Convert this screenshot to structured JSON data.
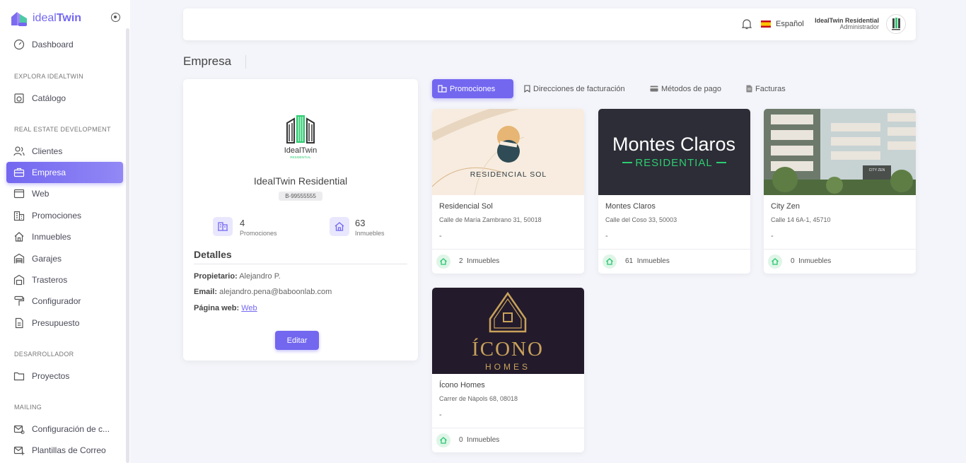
{
  "brand": {
    "name_light": "ideal",
    "name_bold": "Twin"
  },
  "sidebar": {
    "dashboard": "Dashboard",
    "section1": "EXPLORA IDEALTWIN",
    "catalogo": "Catálogo",
    "section2": "REAL ESTATE DEVELOPMENT",
    "items": [
      "Clientes",
      "Empresa",
      "Web",
      "Promociones",
      "Inmuebles",
      "Garajes",
      "Trasteros",
      "Configurador",
      "Presupuesto"
    ],
    "section3": "DESARROLLADOR",
    "proyectos": "Proyectos",
    "section4": "MAILING",
    "mailing": [
      "Configuración de c...",
      "Plantillas de Correo"
    ]
  },
  "topbar": {
    "language": "Español",
    "user_name": "IdealTwin Residential",
    "user_role": "Administrador"
  },
  "page": {
    "title": "Empresa"
  },
  "company": {
    "logo_text": "IdealTwin",
    "logo_sub": "RESIDENTIAL",
    "name": "IdealTwin Residential",
    "id": "B-99555555",
    "promociones_count": "4",
    "promociones_label": "Promociones",
    "inmuebles_count": "63",
    "inmuebles_label": "Inmuebles",
    "details_title": "Detalles",
    "owner_label": "Propietario:",
    "owner": "Alejandro P.",
    "email_label": "Email:",
    "email": "alejandro.pena@baboonlab.com",
    "web_label": "Página web:",
    "web": "Web",
    "edit": "Editar"
  },
  "tabs": [
    "Promociones",
    "Direcciones de facturación",
    "Métodos de pago",
    "Facturas"
  ],
  "promotions": [
    {
      "name": "Residencial Sol",
      "address": "Calle de María Zambrano 31, 50018",
      "extra": "-",
      "count": "2",
      "count_label": "Inmuebles",
      "image_text": "RESIDENCIAL SOL"
    },
    {
      "name": "Montes Claros",
      "address": "Calle del Coso 33, 50003",
      "extra": "-",
      "count": "61",
      "count_label": "Inmuebles",
      "image_text": "Montes Claros",
      "image_sub": "RESIDENTIAL"
    },
    {
      "name": "City Zen",
      "address": "Calle 14 6A-1, 45710",
      "extra": "-",
      "count": "0",
      "count_label": "Inmuebles",
      "image_text": "CITY ZEN"
    },
    {
      "name": "Ícono Homes",
      "address": "Carrer de Nàpols 68, 08018",
      "extra": "-",
      "count": "0",
      "count_label": "Inmuebles",
      "image_text": "ÍCONO",
      "image_sub": "HOMES"
    }
  ]
}
